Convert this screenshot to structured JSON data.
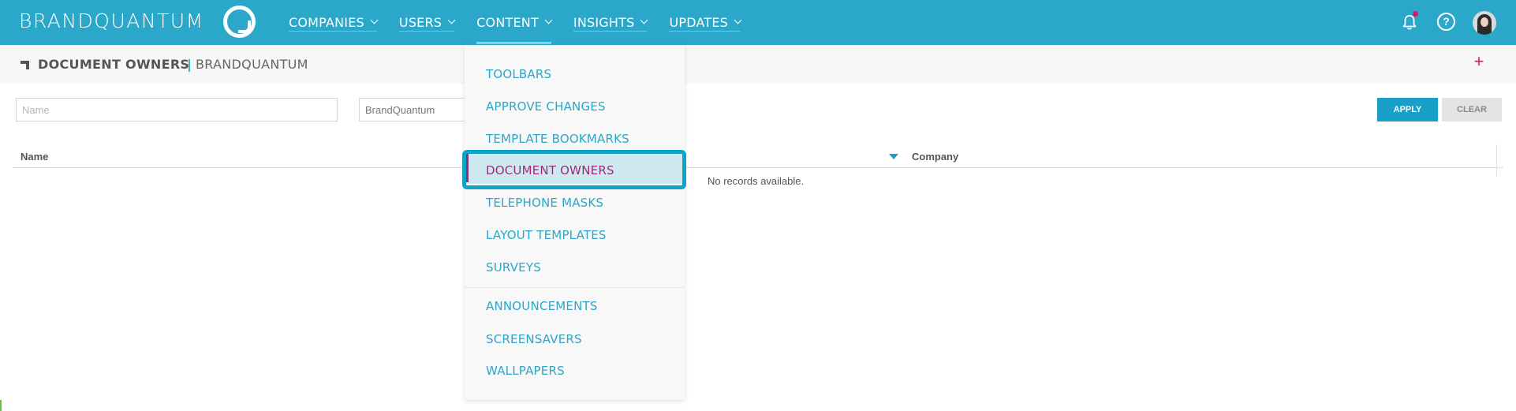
{
  "brand": {
    "logo_text": "BRANDQUANTUM"
  },
  "nav": {
    "items": [
      {
        "label": "COMPANIES"
      },
      {
        "label": "USERS"
      },
      {
        "label": "CONTENT"
      },
      {
        "label": "INSIGHTS"
      },
      {
        "label": "UPDATES"
      }
    ],
    "active": "CONTENT"
  },
  "header_icons": [
    "bell-icon",
    "help-icon",
    "avatar"
  ],
  "subheader": {
    "title": "DOCUMENT OWNERS",
    "separator": "|",
    "company": "BRANDQUANTUM",
    "add_label": "+"
  },
  "filters": {
    "name_placeholder": "Name",
    "company_value": "BrandQuantum",
    "apply_label": "APPLY",
    "clear_label": "CLEAR"
  },
  "table": {
    "columns": [
      "Name",
      "Company"
    ],
    "empty_text": "No records available."
  },
  "content_menu": {
    "items": [
      {
        "label": "TOOLBARS"
      },
      {
        "label": "APPROVE CHANGES"
      },
      {
        "label": "TEMPLATE BOOKMARKS"
      },
      {
        "label": "DOCUMENT OWNERS"
      },
      {
        "label": "TELEPHONE MASKS"
      },
      {
        "label": "LAYOUT TEMPLATES"
      },
      {
        "label": "SURVEYS"
      },
      {
        "label": "ANNOUNCEMENTS"
      },
      {
        "label": "SCREENSAVERS"
      },
      {
        "label": "WALLPAPERS"
      }
    ],
    "selected": "DOCUMENT OWNERS"
  },
  "colors": {
    "topbar": "#2aa7c9",
    "accent": "#1aa0c8",
    "selected_text": "#9a2b7a",
    "notification": "#e0146a"
  }
}
